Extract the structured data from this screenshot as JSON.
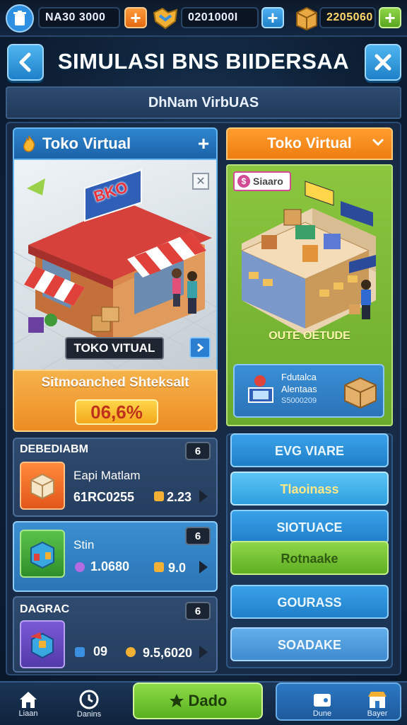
{
  "resources": [
    {
      "icon": "trash-can-icon",
      "value": "NA30 3000",
      "color": "#2f8fe0"
    },
    {
      "icon": "handshake-icon",
      "value": "0201000I",
      "color": "#f2b134"
    },
    {
      "icon": "box-icon",
      "value": "2205060",
      "color": "#e9a842"
    }
  ],
  "header": {
    "title": "SIMULASI BNS BIIDERSAA",
    "subtitle": "DhNam VirbUAS"
  },
  "left_card": {
    "head_label": "Toko Virtual",
    "shop_sign": "BKO",
    "shop_label": "TOKO VITUAL",
    "footer_text": "Sitmoanched Shteksalt",
    "percent": "06,6%"
  },
  "right_card": {
    "head_label": "Toko Virtual",
    "tag_label": "Siaaro",
    "caption": "OUTE OETUDE",
    "info_lines": [
      "Fdutalca",
      "Alentaas",
      "S5000209"
    ]
  },
  "list": [
    {
      "title": "DEBEDIABM",
      "badge": "6",
      "name": "Eapi Matlam",
      "left_value": "61RC0255",
      "right_value": "2.23"
    },
    {
      "title": "",
      "badge": "6",
      "name": "Stin",
      "left_value": "1.0680",
      "right_value": "9.0"
    },
    {
      "title": "DAGRAC",
      "badge": "6",
      "name": "",
      "left_value": "09",
      "right_value": "9.5,6020"
    }
  ],
  "right_buttons": [
    "EVG VIARE",
    "Tlaoinass",
    "SIOTUACE",
    "Rotnaake",
    "GOURASS",
    "SOADAKE"
  ],
  "bottom_nav": {
    "left1": "Liaan",
    "left2": "Danins",
    "cta": "Dado",
    "right1": "Dune",
    "right2": "Bayer"
  }
}
